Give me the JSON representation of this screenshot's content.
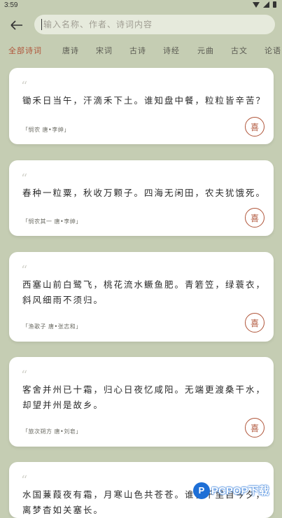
{
  "status_bar": {
    "time": "3:59"
  },
  "search": {
    "placeholder": "输入名称、作者、诗词内容"
  },
  "tabs": [
    "全部诗词",
    "唐诗",
    "宋词",
    "古诗",
    "诗经",
    "元曲",
    "古文",
    "论语"
  ],
  "active_tab": 0,
  "cards": [
    {
      "quote": "“",
      "text": "锄禾日当午，汗滴禾下土。谁知盘中餐，粒粒皆辛苦？",
      "source": "「悯农 唐•李绅」",
      "like_label": "喜"
    },
    {
      "quote": "“",
      "text": "春种一粒粟，秋收万颗子。四海无闲田，农夫犹饿死。",
      "source": "「悯农其一 唐•李绅」",
      "like_label": "喜"
    },
    {
      "quote": "“",
      "text": "西塞山前白鹭飞，桃花流水鳜鱼肥。青箬笠，绿蓑衣，斜风细雨不须归。",
      "source": "「渔歌子 唐•张志和」",
      "like_label": "喜"
    },
    {
      "quote": "“",
      "text": "客舍并州已十霜，归心日夜忆咸阳。无端更渡桑干水，却望并州是故乡。",
      "source": "「旅次朔方 唐•刘皂」",
      "like_label": "喜"
    },
    {
      "quote": "“",
      "text": "水国蒹葭夜有霜，月寒山色共苍苍。谁言千里自今夕，离梦杳如关塞长。",
      "source": "",
      "like_label": ""
    }
  ],
  "watermark": {
    "logo": "P",
    "text": "PCPOP下载"
  },
  "colors": {
    "background": "#c5cdb3",
    "accent": "#b0553a",
    "card": "#ffffff"
  }
}
